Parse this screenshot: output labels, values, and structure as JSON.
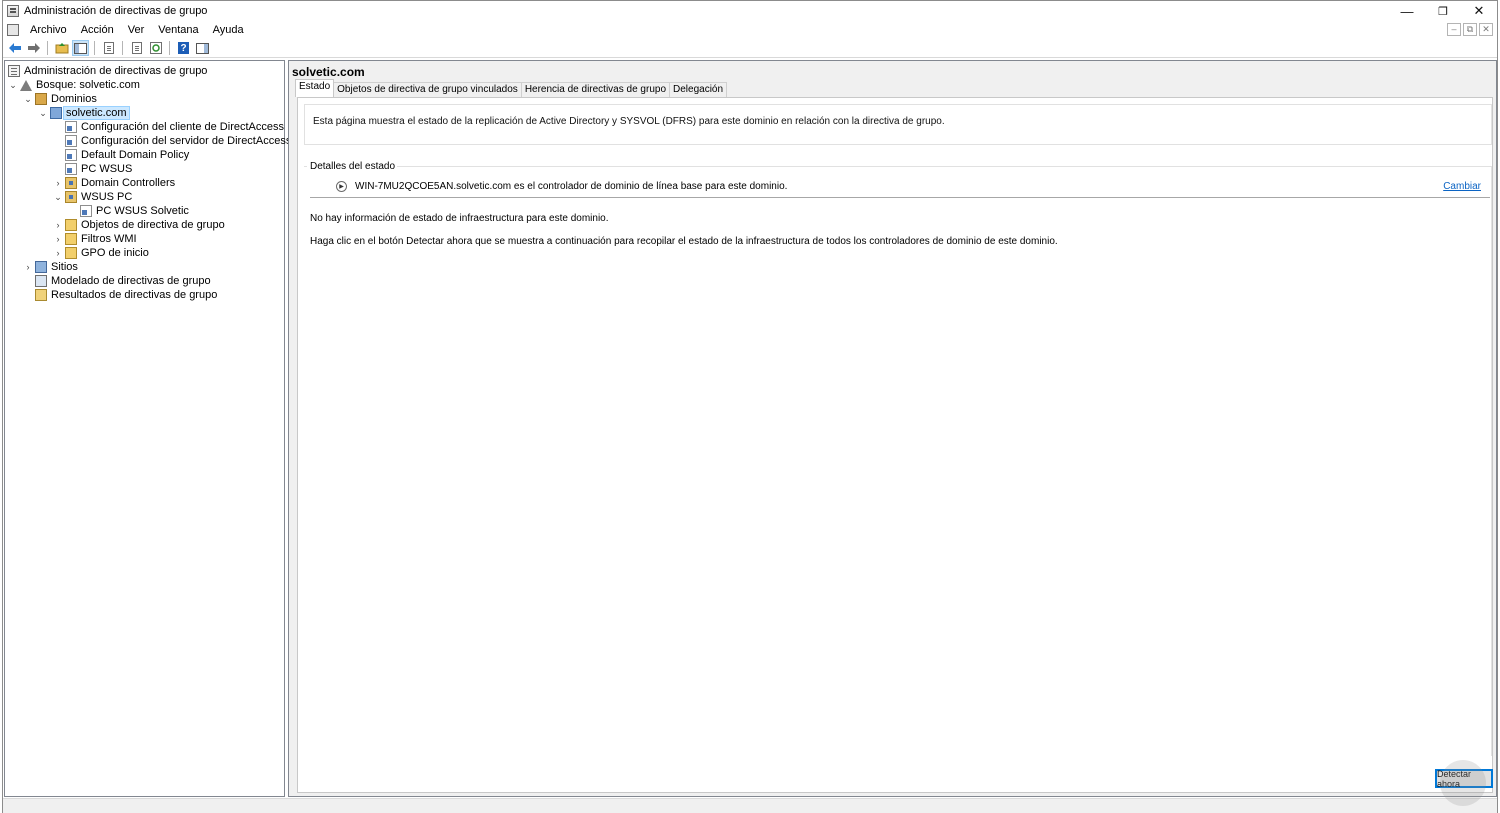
{
  "window": {
    "title": "Administración de directivas de grupo",
    "controls": {
      "minimize": "—",
      "maximize": "❐",
      "close": "✕"
    }
  },
  "menu": {
    "items": [
      "Archivo",
      "Acción",
      "Ver",
      "Ventana",
      "Ayuda"
    ],
    "mdi": {
      "minimize": "–",
      "restore": "⧉",
      "close": "✕"
    }
  },
  "toolbar": {
    "buttons": [
      "back-icon",
      "forward-icon",
      "up-folder-icon",
      "show-hide-tree-icon",
      "properties-icon",
      "export-list-icon",
      "refresh-icon",
      "help-icon",
      "action-pane-icon"
    ],
    "active": "show-hide-tree-icon",
    "help_glyph": "?"
  },
  "tree": {
    "root": "Administración de directivas de grupo",
    "forest": "Bosque: solvetic.com",
    "domains": "Dominios",
    "domain": "solvetic.com",
    "children": [
      "Configuración del cliente de DirectAccess",
      "Configuración del servidor de DirectAccess",
      "Default Domain Policy",
      "PC WSUS",
      "Domain Controllers",
      "WSUS PC",
      "PC WSUS Solvetic",
      "Objetos de directiva de grupo",
      "Filtros WMI",
      "GPO de inicio"
    ],
    "sites": "Sitios",
    "modeling": "Modelado de directivas de grupo",
    "results": "Resultados de directivas de grupo",
    "arrow_expanded": "⌄",
    "arrow_collapsed": "›"
  },
  "content": {
    "title": "solvetic.com",
    "tabs": [
      "Estado",
      "Objetos de directiva de grupo vinculados",
      "Herencia de directivas de grupo",
      "Delegación"
    ],
    "active_tab": "Estado",
    "intro": "Esta página muestra el estado de la replicación de Active Directory y SYSVOL (DFRS) para este dominio en relación con la directiva de grupo.",
    "details_label": "Detalles del estado",
    "dc_text": "WIN-7MU2QCOE5AN.solvetic.com es el controlador de dominio de línea base para este dominio.",
    "change_link": "Cambiar",
    "no_info": "No hay información de estado de infraestructura para este dominio.",
    "instructions": "Haga clic en el botón Detectar ahora que se muestra a continuación para recopilar el estado de la infraestructura de todos los controladores de dominio de este dominio.",
    "detect_button": "Detectar ahora"
  }
}
